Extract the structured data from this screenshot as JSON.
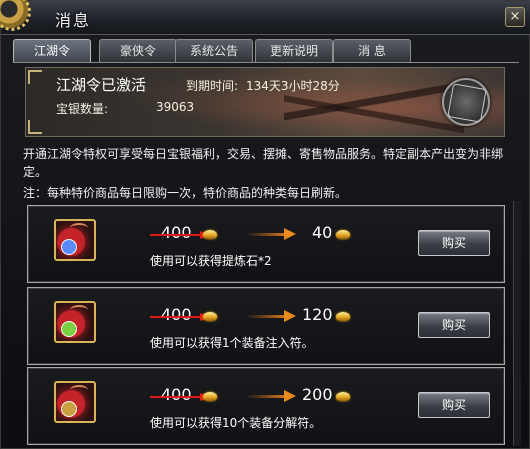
{
  "window": {
    "title": "消息",
    "close_label": "×"
  },
  "tabs": [
    {
      "label": "江湖令",
      "active": true
    },
    {
      "label": "豪侠令",
      "active": false
    },
    {
      "label": "系统公告",
      "active": false
    },
    {
      "label": "更新说明",
      "active": false
    },
    {
      "label": "消  息",
      "active": false
    }
  ],
  "banner": {
    "title": "江湖令已激活",
    "expiry_label": "到期时间:",
    "expiry_value": "134天3小时28分",
    "silver_label": "宝银数量:",
    "silver_value": "39063"
  },
  "description": "开通江湖令特权可享受每日宝银福利，交易、摆摊、寄售物品服务。特定副本产出变为非绑定。",
  "note": "注：每种特价商品每日限购一次，特价商品的种类每日刷新。",
  "items": [
    {
      "old_price": "400",
      "new_price": "40",
      "desc": "使用可以获得提炼石*2",
      "buy_label": "购买",
      "gem_color": "#5a8cff"
    },
    {
      "old_price": "400",
      "new_price": "120",
      "desc": "使用可以获得1个装备注入符。",
      "buy_label": "购买",
      "gem_color": "#7ad040"
    },
    {
      "old_price": "400",
      "new_price": "200",
      "desc": "使用可以获得10个装备分解符。",
      "buy_label": "购买",
      "gem_color": "#c8a040"
    }
  ],
  "colors": {
    "accent_gold": "#d9b55a",
    "strike_red": "#e01818",
    "arrow_orange": "#e88a1c"
  },
  "icons": {
    "title": "gear-icon",
    "banner_seal": "seal-icon",
    "currency": "ingot-icon",
    "item": "pouch-icon"
  }
}
